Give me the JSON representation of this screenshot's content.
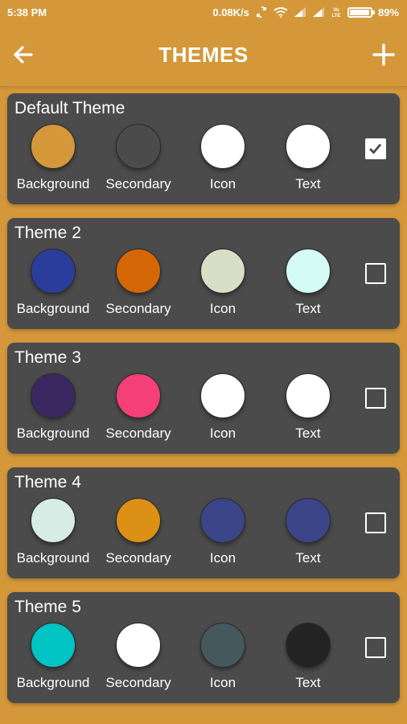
{
  "status_bar": {
    "time": "5:38 PM",
    "net_speed": "0.08K/s",
    "carrier": "VoLTE",
    "battery": "89%",
    "battery_level": 0.89
  },
  "app_bar": {
    "title": "THEMES",
    "back_icon": "arrow-left-icon",
    "add_icon": "plus-icon"
  },
  "labels": {
    "background": "Background",
    "secondary": "Secondary",
    "icon": "Icon",
    "text": "Text"
  },
  "themes": [
    {
      "name": "Default Theme",
      "colors": {
        "background": "#d4983a",
        "secondary": "#4b4b4b",
        "icon": "#ffffff",
        "text": "#ffffff"
      },
      "selected": true
    },
    {
      "name": "Theme 2",
      "colors": {
        "background": "#2a3d9a",
        "secondary": "#d46606",
        "icon": "#d8dfc6",
        "text": "#d4fbf6"
      },
      "selected": false
    },
    {
      "name": "Theme 3",
      "colors": {
        "background": "#3b2760",
        "secondary": "#f43f78",
        "icon": "#ffffff",
        "text": "#ffffff"
      },
      "selected": false
    },
    {
      "name": "Theme 4",
      "colors": {
        "background": "#d6ece4",
        "secondary": "#dc9016",
        "icon": "#3b4588",
        "text": "#3b4588"
      },
      "selected": false
    },
    {
      "name": "Theme 5",
      "colors": {
        "background": "#00c4c4",
        "secondary": "#ffffff",
        "icon": "#44585e",
        "text": "#232323"
      },
      "selected": false
    }
  ]
}
